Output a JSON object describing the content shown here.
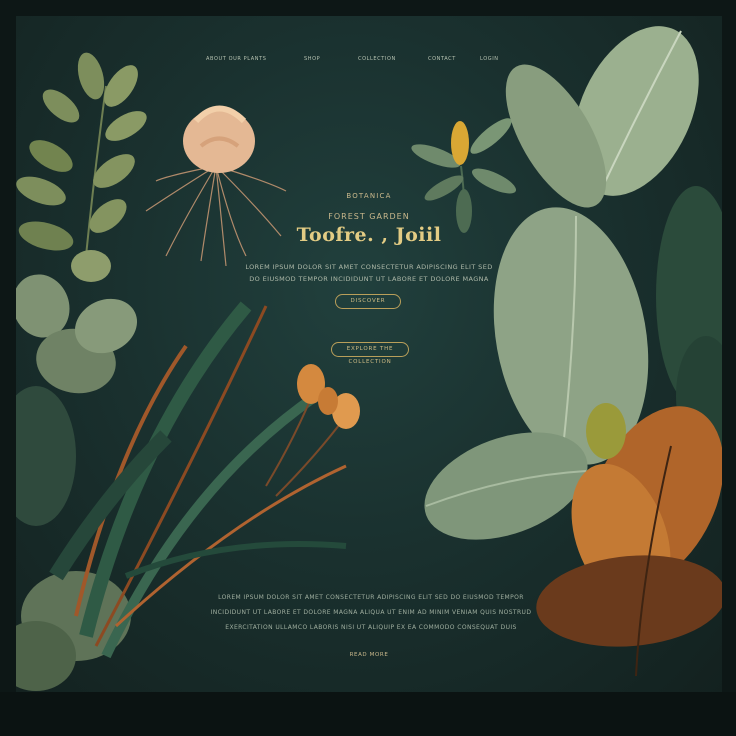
{
  "nav": {
    "links": [
      "ABOUT OUR PLANTS",
      "SHOP",
      "COLLECTION",
      "CONTACT",
      "LOGIN"
    ]
  },
  "hero": {
    "eyebrow": "BOTANICA",
    "subtitle": "FOREST GARDEN",
    "title": "Toofre. , Joiil",
    "description_lines": [
      "LOREM IPSUM DOLOR SIT AMET CONSECTETUR ADIPISCING ELIT SED",
      "DO EIUSMOD TEMPOR INCIDIDUNT UT LABORE ET DOLORE MAGNA"
    ],
    "primary_button": "DISCOVER",
    "secondary_button": "EXPLORE THE COLLECTION"
  },
  "footer": {
    "lines": [
      "LOREM IPSUM DOLOR SIT AMET CONSECTETUR ADIPISCING ELIT SED DO EIUSMOD TEMPOR",
      "INCIDIDUNT UT LABORE ET DOLORE MAGNA ALIQUA UT ENIM AD MINIM VENIAM QUIS NOSTRUD",
      "EXERCITATION ULLAMCO LABORIS NISI UT ALIQUIP EX EA COMMODO CONSEQUAT DUIS"
    ],
    "link": "READ MORE"
  },
  "colors": {
    "background": "#1a312f",
    "accent_gold": "#e3cc84",
    "leaf_sage": "#8fa582",
    "leaf_dark": "#2c4a3c",
    "leaf_rust": "#a0582a"
  }
}
